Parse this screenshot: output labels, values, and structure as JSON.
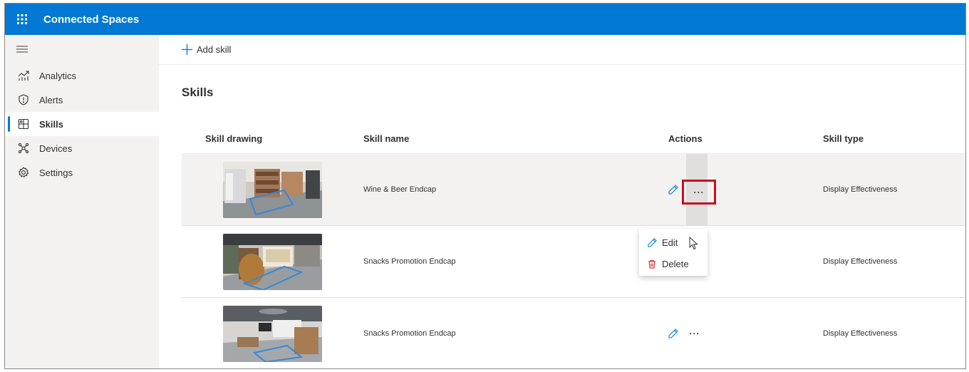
{
  "app": {
    "title": "Connected Spaces"
  },
  "sidebar": {
    "items": [
      {
        "label": "Analytics",
        "icon": "analytics-icon"
      },
      {
        "label": "Alerts",
        "icon": "shield-icon"
      },
      {
        "label": "Skills",
        "icon": "skills-icon",
        "active": true
      },
      {
        "label": "Devices",
        "icon": "devices-icon"
      },
      {
        "label": "Settings",
        "icon": "gear-icon"
      }
    ]
  },
  "toolbar": {
    "add_label": "Add skill"
  },
  "page": {
    "title": "Skills"
  },
  "table": {
    "columns": [
      "Skill drawing",
      "Skill name",
      "Actions",
      "Skill type"
    ],
    "rows": [
      {
        "name": "Wine & Beer Endcap",
        "type": "Display Effectiveness"
      },
      {
        "name": "Snacks Promotion Endcap",
        "type": "Display Effectiveness"
      },
      {
        "name": "Snacks Promotion Endcap",
        "type": "Display Effectiveness"
      }
    ]
  },
  "context_menu": {
    "items": [
      {
        "label": "Edit",
        "icon": "pencil-icon"
      },
      {
        "label": "Delete",
        "icon": "trash-icon"
      }
    ]
  },
  "colors": {
    "brand": "#0078d4",
    "highlight": "#c50f1f",
    "delete_icon": "#d13438"
  }
}
